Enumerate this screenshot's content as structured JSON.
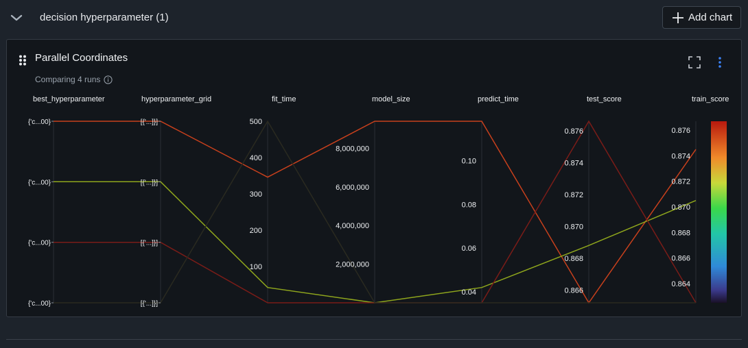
{
  "section": {
    "title": "decision hyperparameter (1)",
    "expand_icon": "chevron-down-icon"
  },
  "toolbar": {
    "add_chart_label": "Add chart",
    "add_icon": "plus-icon"
  },
  "card": {
    "title": "Parallel Coordinates",
    "subtitle": "Comparing 4 runs",
    "icons": [
      "drag-handle-icon",
      "info-icon",
      "fullscreen-icon",
      "more-vertical-icon"
    ]
  },
  "colors": {
    "background": "#1d232b",
    "panel": "#12161b",
    "accent": "#3b82f6"
  },
  "chart_data": {
    "type": "parallel-coordinates",
    "colorscale": "rainbow",
    "color_by": "train_score",
    "axes": [
      {
        "name": "best_hyperparameter",
        "kind": "categorical",
        "ticks": [
          "{'c...00}",
          "{'c...00}",
          "{'c...00}",
          "{'c...00}"
        ]
      },
      {
        "name": "hyperparameter_grid",
        "kind": "categorical",
        "ticks": [
          "[{'...]}]",
          "[{'...]}]",
          "[{'...]}]",
          "[{'...]}]"
        ]
      },
      {
        "name": "fit_time",
        "kind": "numeric",
        "range": [
          0,
          500
        ],
        "ticks": [
          100,
          200,
          300,
          400,
          500
        ],
        "tick_labels": [
          "100",
          "200",
          "300",
          "400",
          "500"
        ]
      },
      {
        "name": "model_size",
        "kind": "numeric",
        "range": [
          0,
          9400000
        ],
        "ticks": [
          2000000,
          4000000,
          6000000,
          8000000
        ],
        "tick_labels": [
          "2,000,000",
          "4,000,000",
          "6,000,000",
          "8,000,000"
        ]
      },
      {
        "name": "predict_time",
        "kind": "numeric",
        "range": [
          0.035,
          0.118
        ],
        "ticks": [
          0.04,
          0.06,
          0.08,
          0.1
        ],
        "tick_labels": [
          "0.04",
          "0.06",
          "0.08",
          "0.10"
        ]
      },
      {
        "name": "test_score",
        "kind": "numeric",
        "range": [
          0.8652,
          0.8766
        ],
        "ticks": [
          0.866,
          0.868,
          0.87,
          0.872,
          0.874,
          0.876
        ],
        "tick_labels": [
          "0.866",
          "0.868",
          "0.870",
          "0.872",
          "0.874",
          "0.876"
        ]
      },
      {
        "name": "train_score",
        "kind": "numeric",
        "range": [
          0.8625,
          0.8767
        ],
        "ticks": [
          0.864,
          0.866,
          0.868,
          0.87,
          0.872,
          0.874,
          0.876
        ],
        "tick_labels": [
          "0.864",
          "0.866",
          "0.868",
          "0.870",
          "0.872",
          "0.874",
          "0.876"
        ]
      }
    ],
    "runs": [
      {
        "values": [
          0,
          0,
          346,
          9400000,
          0.118,
          0.8652,
          0.8745
        ],
        "color": "#c8401c"
      },
      {
        "values": [
          1,
          1,
          42,
          0,
          0.042,
          0.8688,
          0.8705
        ],
        "color": "#8fa61c"
      },
      {
        "values": [
          2,
          2,
          0,
          0,
          0.035,
          0.8766,
          0.8625
        ],
        "color": "#7a1c18"
      },
      {
        "values": [
          3,
          3,
          500,
          0,
          0.035,
          0.8652,
          0.8625
        ],
        "color": "#2a2a20"
      }
    ]
  }
}
